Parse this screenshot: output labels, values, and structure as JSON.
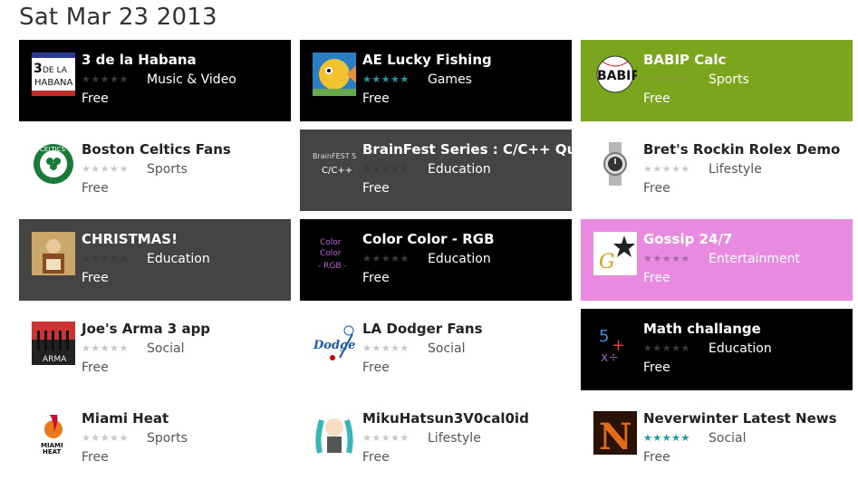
{
  "date": "Sat Mar 23 2013",
  "colors": {
    "black": "#000000",
    "gray": "#444444",
    "green": "#7aa51c",
    "pink": "#e88be0",
    "white": "#ffffff",
    "star_teal": "#1b9aa6"
  },
  "apps": [
    {
      "name": "3 de la Habana",
      "category": "Music & Video",
      "price": "Free",
      "rating": 0,
      "bg": "black",
      "icon": "habana-logo-icon"
    },
    {
      "name": "AE Lucky Fishing",
      "category": "Games",
      "price": "Free",
      "rating": 5,
      "bg": "black",
      "icon": "fish-icon"
    },
    {
      "name": "BABIP Calc",
      "category": "Sports",
      "price": "Free",
      "rating": 0,
      "bg": "green",
      "icon": "babip-baseball-icon"
    },
    {
      "name": "Boston Celtics Fans",
      "category": "Sports",
      "price": "Free",
      "rating": 0,
      "bg": "white",
      "icon": "celtics-logo-icon"
    },
    {
      "name": "BrainFest Series : C/C++ Quiz",
      "category": "Education",
      "price": "Free",
      "rating": 0,
      "bg": "gray",
      "icon": "brainfest-icon"
    },
    {
      "name": "Bret's Rockin Rolex Demo",
      "category": "Lifestyle",
      "price": "Free",
      "rating": 0,
      "bg": "white",
      "icon": "watch-icon"
    },
    {
      "name": "CHRISTMAS!",
      "category": "Education",
      "price": "Free",
      "rating": 0,
      "bg": "gray",
      "icon": "christmas-painting-icon"
    },
    {
      "name": "Color Color - RGB",
      "category": "Education",
      "price": "Free",
      "rating": 0,
      "bg": "black",
      "icon": "color-text-icon"
    },
    {
      "name": "Gossip 24/7",
      "category": "Entertainment",
      "price": "Free",
      "rating": 0,
      "bg": "pink",
      "icon": "gossip-star-icon"
    },
    {
      "name": "Joe's Arma 3 app",
      "category": "Social",
      "price": "Free",
      "rating": 0,
      "bg": "white",
      "icon": "arma-icon"
    },
    {
      "name": "LA Dodger Fans",
      "category": "Social",
      "price": "Free",
      "rating": 0,
      "bg": "white",
      "icon": "dodgers-logo-icon"
    },
    {
      "name": "Math challange",
      "category": "Education",
      "price": "Free",
      "rating": 0,
      "bg": "black",
      "icon": "math-icon"
    },
    {
      "name": "Miami Heat",
      "category": "Sports",
      "price": "Free",
      "rating": 0,
      "bg": "white",
      "icon": "heat-logo-icon"
    },
    {
      "name": "MikuHatsun3V0cal0id",
      "category": "Lifestyle",
      "price": "Free",
      "rating": 0,
      "bg": "white",
      "icon": "miku-icon"
    },
    {
      "name": "Neverwinter Latest News",
      "category": "Social",
      "price": "Free",
      "rating": 5,
      "bg": "white",
      "icon": "neverwinter-icon"
    }
  ]
}
